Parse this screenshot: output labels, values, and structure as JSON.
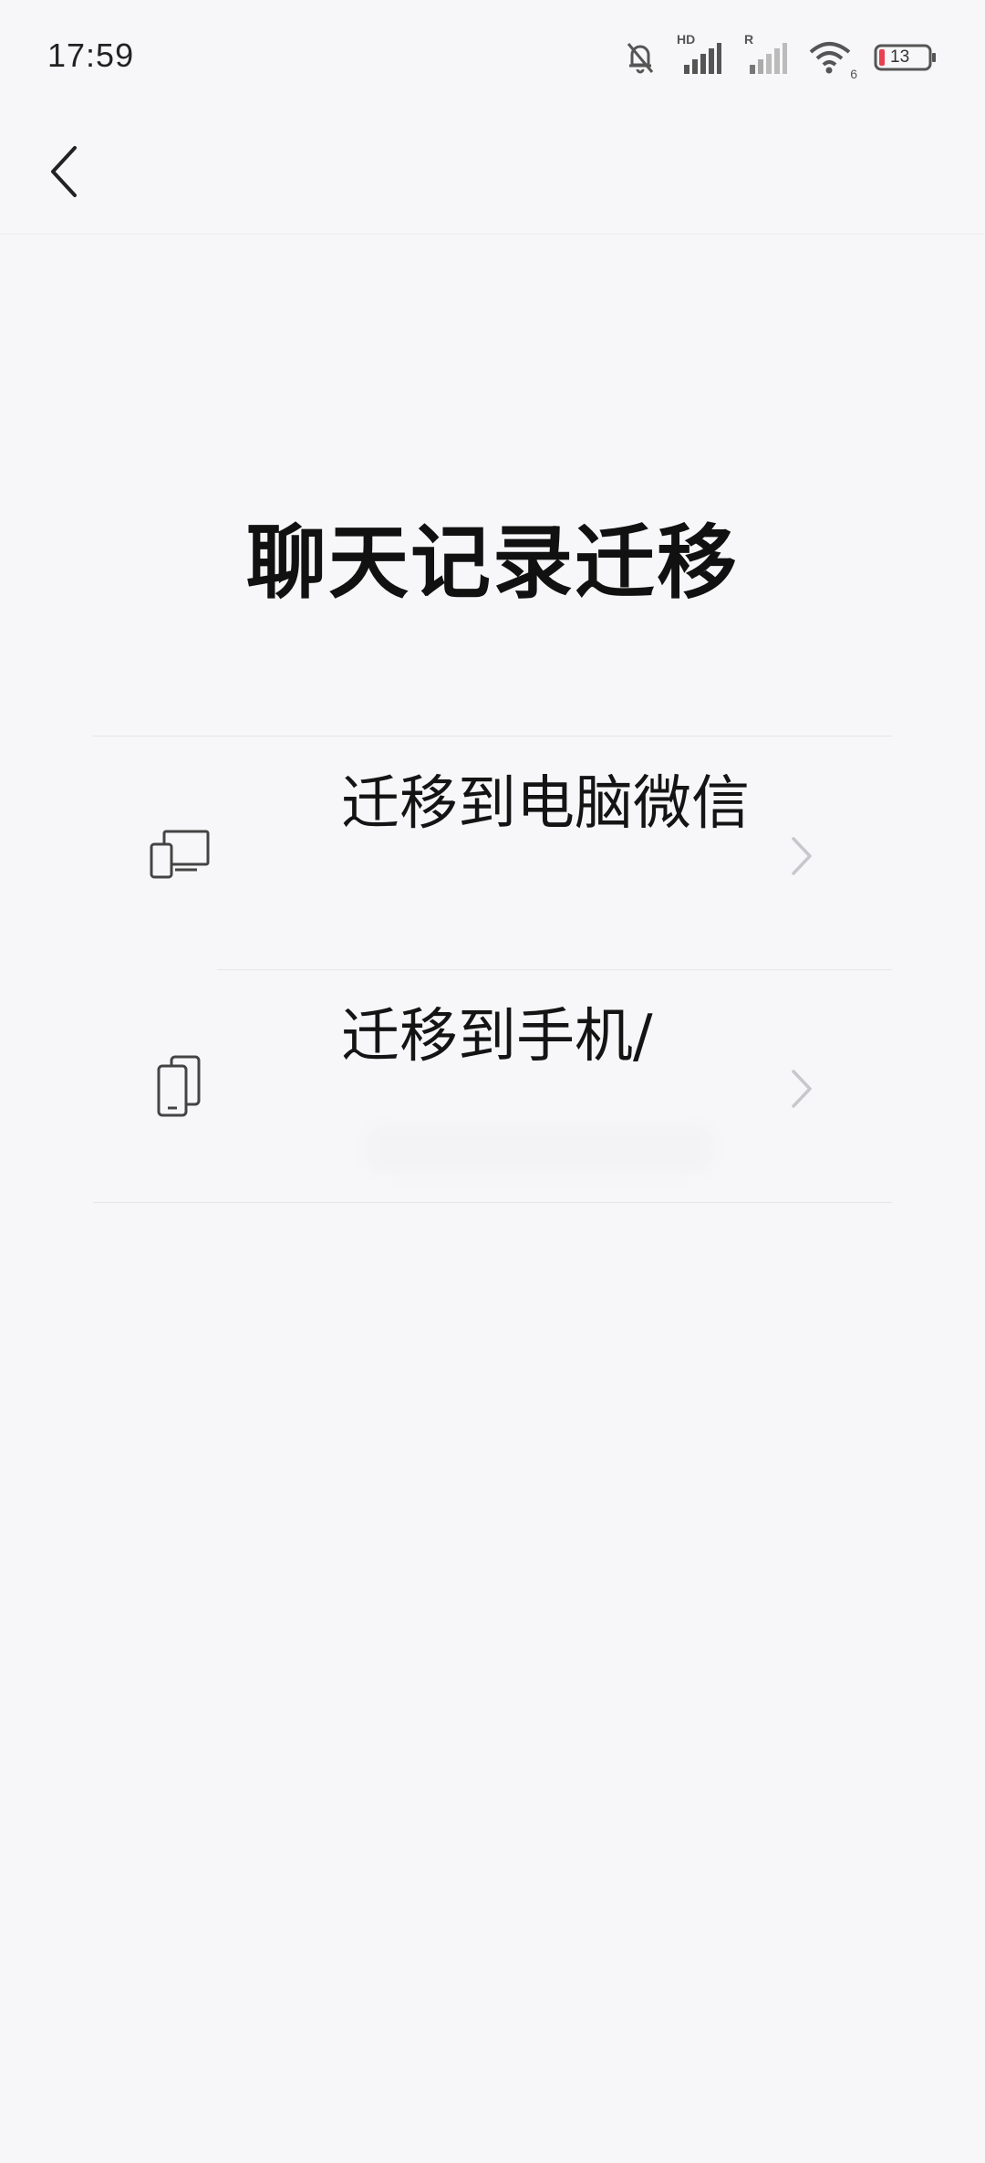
{
  "status_bar": {
    "time": "17:59",
    "network_hd_label": "HD",
    "network_r_label": "R",
    "wifi_badge": "6",
    "battery_level": "13"
  },
  "nav": {
    "back_icon": "chevron-left-icon"
  },
  "page": {
    "title": "聊天记录迁移"
  },
  "options": [
    {
      "label": "迁移到电脑微信",
      "icon": "computer-phone-icon"
    },
    {
      "label": "迁移到手机/",
      "icon": "phones-icon"
    }
  ],
  "colors": {
    "background": "#f7f7f9",
    "text": "#111111",
    "divider": "#e6e6e8",
    "chevron": "#c8c8cc",
    "battery_low": "#e8414f"
  }
}
